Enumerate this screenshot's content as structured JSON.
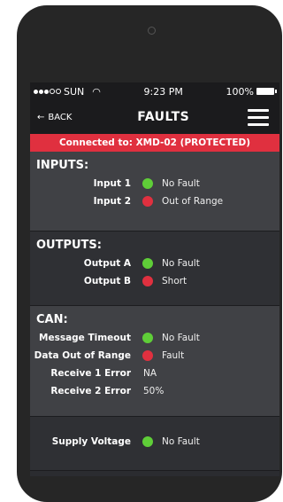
{
  "status_bar": {
    "carrier": "SUN",
    "time": "9:23 PM",
    "battery": "100%"
  },
  "nav": {
    "back_label": "BACK",
    "title": "FAULTS"
  },
  "banner": "Connected to: XMD-02 (PROTECTED)",
  "colors": {
    "ok": "#5fce38",
    "fault": "#e0303f"
  },
  "inputs": {
    "title": "INPUTS:",
    "rows": [
      {
        "label": "Input 1",
        "status": "No Fault",
        "state": "ok"
      },
      {
        "label": "Input 2",
        "status": "Out of Range",
        "state": "fault"
      }
    ]
  },
  "outputs": {
    "title": "OUTPUTS:",
    "rows": [
      {
        "label": "Output A",
        "status": "No Fault",
        "state": "ok"
      },
      {
        "label": "Output B",
        "status": "Short",
        "state": "fault"
      }
    ]
  },
  "can": {
    "title": "CAN:",
    "rows": [
      {
        "label": "Message Timeout",
        "status": "No Fault",
        "state": "ok"
      },
      {
        "label": "Data Out of Range",
        "status": "Fault",
        "state": "fault"
      },
      {
        "label": "Receive 1 Error",
        "status": "NA",
        "state": "none"
      },
      {
        "label": "Receive 2 Error",
        "status": "50%",
        "state": "none"
      }
    ]
  },
  "supply": {
    "rows": [
      {
        "label": "Supply Voltage",
        "status": "No Fault",
        "state": "ok"
      }
    ]
  }
}
